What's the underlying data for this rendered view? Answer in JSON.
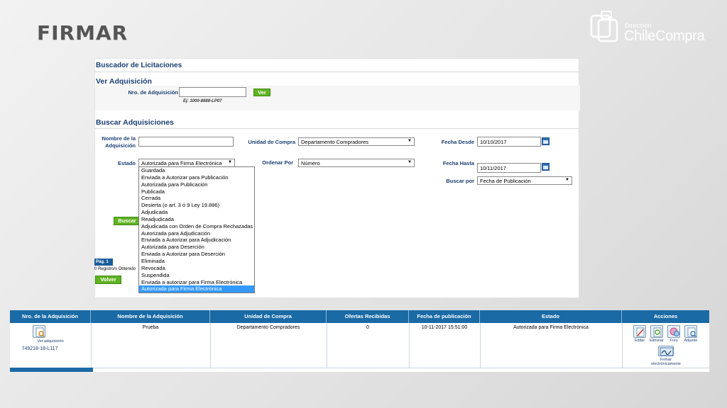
{
  "slide": {
    "title": "FIRMAR"
  },
  "logo": {
    "small": "Dirección",
    "big": "ChileCompra"
  },
  "panel": {
    "title": "Buscador de Licitaciones",
    "ver": {
      "title": "Ver Adquisición",
      "nro_label": "Nro. de Adquisición",
      "nro_value": "",
      "hint": "Ej: 1000-8888-LP07",
      "button": "Ver"
    },
    "buscar": {
      "title": "Buscar Adquisiciones",
      "nombre_label_1": "Nombre de la",
      "nombre_label_2": "Adquisición",
      "nombre_value": "",
      "unidad_label": "Unidad de Compra",
      "unidad_value": "Departamento Compradores",
      "fecha_desde_label": "Fecha Desde",
      "fecha_desde_value": "10/10/2017",
      "estado_label": "Estado",
      "estado_value": "Autorizada para Firma Electrónica",
      "ordenar_label": "Ordenar Por",
      "ordenar_value": "Número",
      "fecha_hasta_label": "Fecha Hasta",
      "fecha_hasta_value": "10/11/2017",
      "buscar_por_label": "Buscar por",
      "buscar_por_value": "Fecha de Publicación",
      "buscar_button": "Buscar",
      "estado_options": [
        "Guardada",
        "Enviada a Autorizar para Publicación",
        "Autorizada para Publicación",
        "Publicada",
        "Cerrada",
        "Desierta (o art. 3 ó 9 Ley 19.886)",
        "Adjudicada",
        "Readjudicada",
        "Adjudicada con Orden de Compra Rechazadas",
        "Autorizada para Adjudicación",
        "Enviada a Autorizar para Adjudicación",
        "Autorizada para Deserción",
        "Enviada a Autorizar para Deserción",
        "Eliminada",
        "Revocada",
        "Suspendida",
        "Enviada a autorizar para Firma Electrónica",
        "Autorizada para Firma Electrónica"
      ],
      "selected_index": 17
    },
    "pagination": {
      "badge": "Pág. 1",
      "text": "0 Registro/s Obtenido"
    },
    "volver_button": "Volver"
  },
  "results": {
    "columns": [
      "Nro. de la Adquisición",
      "Nombre de la Adquisición",
      "Unidad de Compra",
      "Ofertas Recibidas",
      "Fecha de publicación",
      "Estado",
      "Acciones"
    ],
    "row": {
      "ver_label": "Ver adquisición",
      "nro": "749218-18-L117",
      "nombre": "Prueba",
      "unidad": "Departamento Compradores",
      "ofertas": "0",
      "fecha": "10-11-2017 15:51:00",
      "estado": "Autorizada para Firma Electrónica"
    },
    "actions": {
      "editar": "Editar",
      "eliminar": "Eliminar",
      "foro": "Foro",
      "adjunto": "Adjunto",
      "firmar_1": "Firmar",
      "firmar_2": "electrónicamente"
    }
  },
  "colors": {
    "accent": "#1a6aa5",
    "label_blue": "#1a3f73",
    "button_green": "#5fb321",
    "selection": "#3399ff"
  }
}
